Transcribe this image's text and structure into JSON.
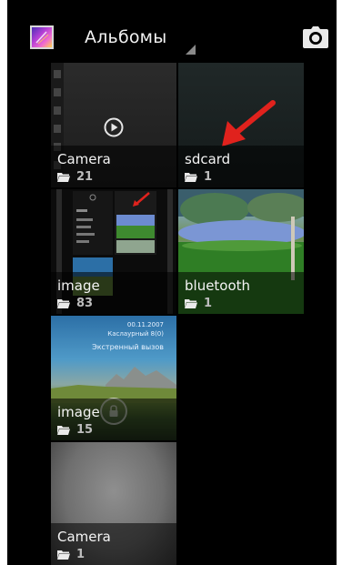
{
  "action_bar": {
    "title": "Альбомы",
    "app_icon": "gallery-app-icon",
    "camera_icon": "camera-icon"
  },
  "albums": [
    {
      "name": "Camera",
      "count": "21",
      "thumb": "video-thumbnail",
      "icon": "folder-icon"
    },
    {
      "name": "sdcard",
      "count": "1",
      "thumb": "red-arrow-thumbnail",
      "icon": "folder-icon"
    },
    {
      "name": "image",
      "count": "83",
      "thumb": "screenshot-thumbnail",
      "icon": "folder-icon"
    },
    {
      "name": "bluetooth",
      "count": "1",
      "thumb": "garden-thumbnail",
      "icon": "folder-icon"
    },
    {
      "name": "image",
      "count": "15",
      "thumb": "lockscreen-thumbnail",
      "icon": "folder-icon"
    },
    {
      "name": "Camera",
      "count": "1",
      "thumb": "blurry-thumbnail",
      "icon": "folder-icon"
    }
  ],
  "lockscreen": {
    "time": "00.11.2007",
    "date": "Каслаурный 8(0)",
    "emergency": "Экстренный вызов"
  },
  "colors": {
    "background": "#000000",
    "title_text": "#f2f2f2",
    "count_text": "#bdbdbd",
    "arrow": "#e0221d"
  }
}
